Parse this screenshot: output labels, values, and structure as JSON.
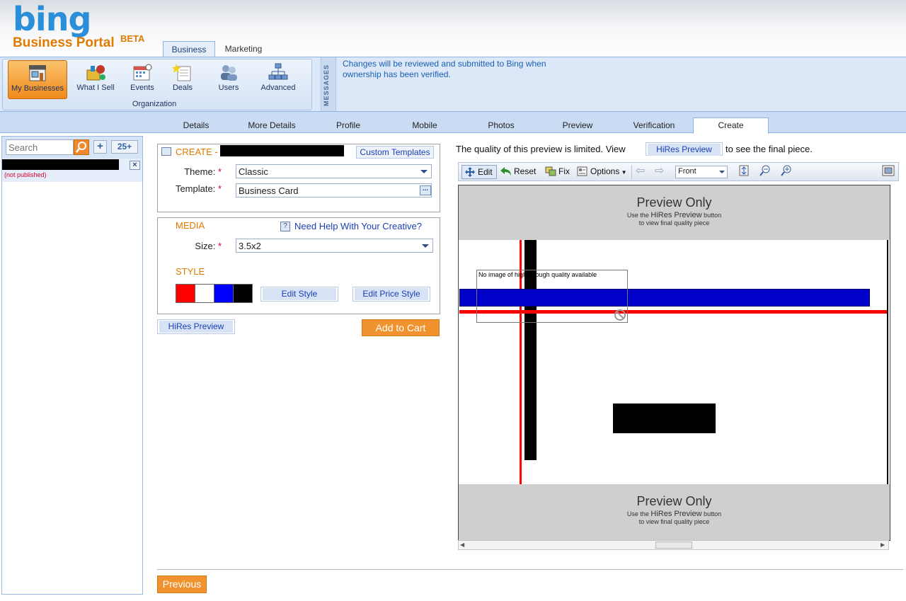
{
  "header": {
    "logo": "bing",
    "portal_title": "Business Portal",
    "portal_badge": "BETA",
    "tabs": [
      {
        "label": "Business"
      },
      {
        "label": "Marketing"
      }
    ]
  },
  "ribbon": {
    "buttons": [
      {
        "label": "My Businesses",
        "icon": "store-icon"
      },
      {
        "label": "What I Sell",
        "icon": "products-icon"
      },
      {
        "label": "Events",
        "icon": "calendar-icon"
      },
      {
        "label": "Deals",
        "icon": "deals-icon"
      },
      {
        "label": "Users",
        "icon": "users-icon"
      },
      {
        "label": "Advanced",
        "icon": "org-chart-icon"
      }
    ],
    "group_label": "Organization",
    "messages_label": "MESSAGES",
    "message": "Changes will be reviewed and submitted to Bing when ownership has been verified."
  },
  "subtabs": [
    {
      "label": "Details"
    },
    {
      "label": "More Details"
    },
    {
      "label": "Profile"
    },
    {
      "label": "Mobile"
    },
    {
      "label": "Photos"
    },
    {
      "label": "Preview"
    },
    {
      "label": "Verification"
    },
    {
      "label": "Create"
    }
  ],
  "sidebar": {
    "search_placeholder": "Search",
    "add_label": "+",
    "count_label": "25+",
    "list_item_status": "(not published)",
    "close_label": "×"
  },
  "create": {
    "title": "CREATE -",
    "custom_templates": "Custom Templates",
    "theme_label": "Theme:",
    "theme_value": "Classic",
    "template_label": "Template:",
    "template_value": "Business Card",
    "template_btn": "...",
    "required_mark": "*"
  },
  "media": {
    "title": "MEDIA",
    "help_link": "Need Help With Your Creative?",
    "size_label": "Size:",
    "size_value": "3.5x2",
    "style_title": "STYLE",
    "swatch_colors": [
      "#ff0000",
      "#ffffff",
      "#0000ff",
      "#000000"
    ],
    "edit_style": "Edit Style",
    "edit_price_style": "Edit Price Style"
  },
  "actions": {
    "hires_preview": "HiRes Preview",
    "add_to_cart": "Add to Cart",
    "previous": "Previous"
  },
  "preview": {
    "note_before": "The quality of this preview is limited. View",
    "note_button": "HiRes Preview",
    "note_after": "to see the final piece.",
    "toolbar": {
      "edit": "Edit",
      "reset": "Reset",
      "fix": "Fix",
      "options": "Options",
      "side": "Front"
    },
    "band_title": "Preview Only",
    "band_sub_1": "Use the",
    "band_sub_hires": "HiRes Preview",
    "band_sub_2": "button",
    "band_sub_3": "to view final quality piece",
    "image_placeholder": "No image of high enough quality available"
  },
  "colors": {
    "accent_orange": "#f0932f",
    "link_blue": "#1a3fb4",
    "tab_blue": "#c9dcf4"
  }
}
